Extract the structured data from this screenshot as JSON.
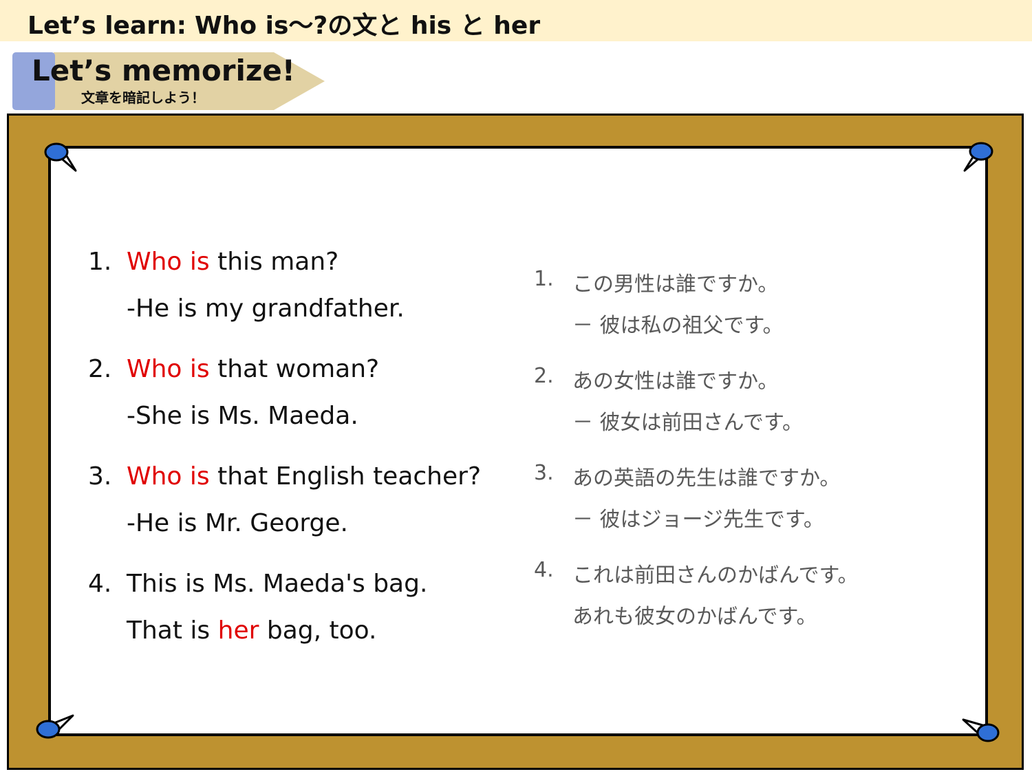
{
  "header": {
    "prefix": "Let’s learn:",
    "title": "Who is～?の文と his と her"
  },
  "banner": {
    "title": "Let’s memorize!",
    "subtitle": "文章を暗記しよう！"
  },
  "english": [
    {
      "num": "1.",
      "q_red": "Who is",
      "q_rest": " this man?",
      "answer": "-He is my grandfather."
    },
    {
      "num": "2.",
      "q_red": "Who is",
      "q_rest": " that woman?",
      "answer": "-She is Ms. Maeda."
    },
    {
      "num": "3.",
      "q_red": "Who is",
      "q_rest": " that English teacher?",
      "answer": "-He is Mr. George."
    },
    {
      "num": "4.",
      "q_text": "This is Ms. Maeda's bag.",
      "a_pre": "That is ",
      "a_red": "her",
      "a_post": " bag, too."
    }
  ],
  "japanese": [
    {
      "num": "1.",
      "q": "この男性は誰ですか。",
      "a": "－ 彼は私の祖父です。"
    },
    {
      "num": "2.",
      "q": "あの女性は誰ですか。",
      "a": "－ 彼女は前田さんです。"
    },
    {
      "num": "3.",
      "q": "あの英語の先生は誰ですか。",
      "a": "－ 彼はジョージ先生です。"
    },
    {
      "num": "4.",
      "q": "これは前田さんのかばんです。",
      "a": "あれも彼女のかばんです。"
    }
  ],
  "colors": {
    "header_bg": "#fff2cc",
    "board": "#be9230",
    "banner_tan": "#e2d2a4",
    "banner_blue": "#94a6dc",
    "pin": "#2f6fd6",
    "highlight_red": "#e00000",
    "jp_text": "#595959"
  }
}
